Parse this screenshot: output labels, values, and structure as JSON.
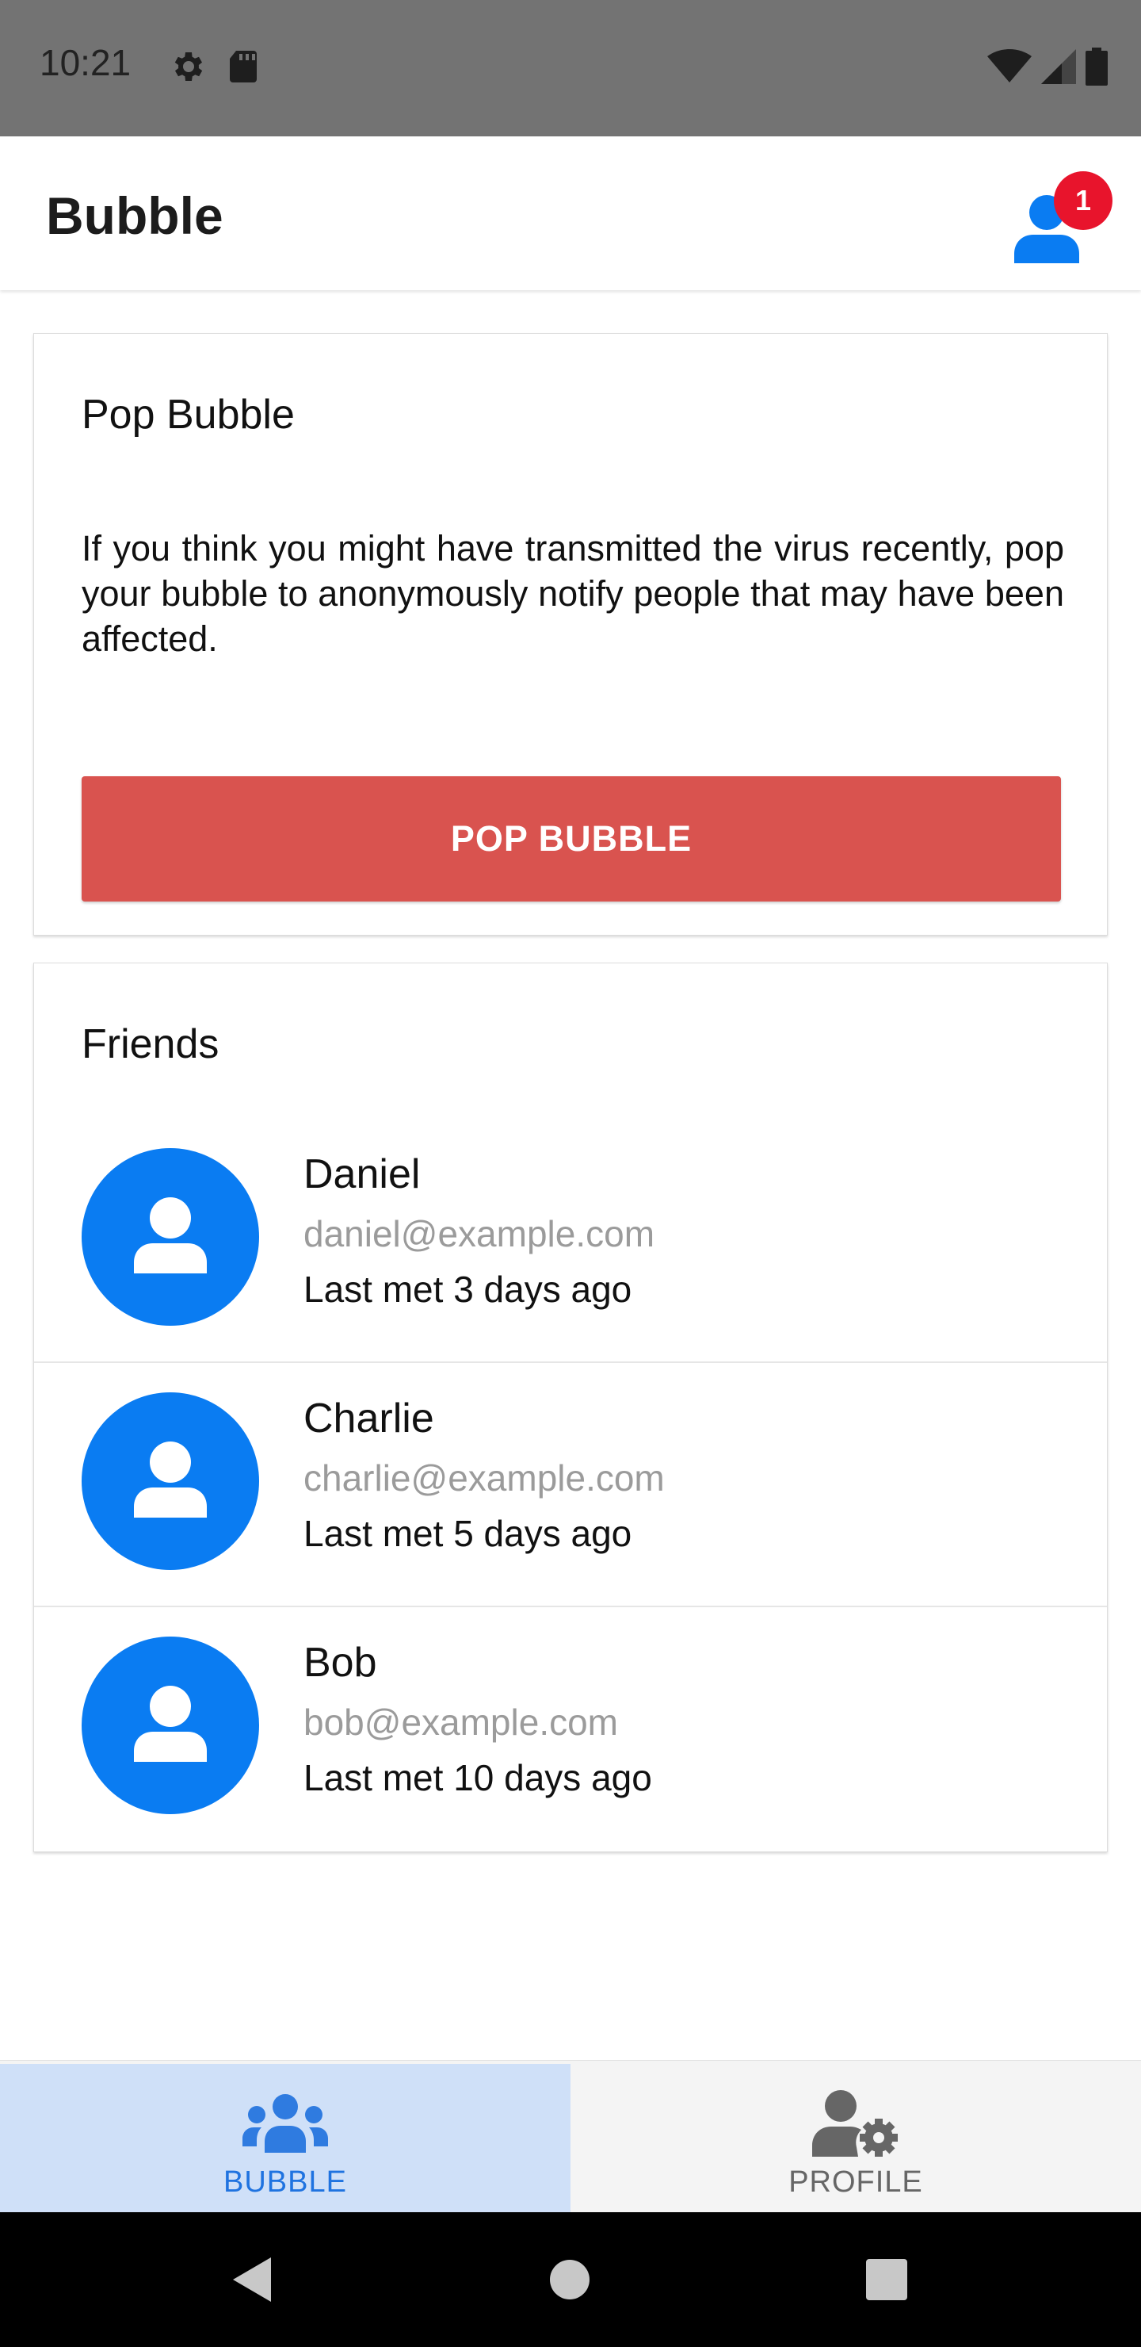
{
  "status_bar": {
    "time": "10:21",
    "icons_left": [
      "settings-icon",
      "sd-card-icon"
    ],
    "icons_right": [
      "wifi-icon",
      "signal-icon",
      "battery-icon"
    ]
  },
  "app_bar": {
    "title": "Bubble",
    "notification_count": "1"
  },
  "pop_card": {
    "title": "Pop Bubble",
    "description": "If you think you might have transmitted the virus recently, pop your bubble to anonymously notify people that may have been affected.",
    "button_label": "POP BUBBLE",
    "button_color": "#d9534f"
  },
  "friends_card": {
    "title": "Friends",
    "friends": [
      {
        "name": "Daniel",
        "email": "daniel@example.com",
        "last_met": "Last met 3 days ago"
      },
      {
        "name": "Charlie",
        "email": "charlie@example.com",
        "last_met": "Last met 5 days ago"
      },
      {
        "name": "Bob",
        "email": "bob@example.com",
        "last_met": "Last met 10 days ago"
      }
    ]
  },
  "bottom_nav": {
    "tabs": [
      {
        "label": "BUBBLE",
        "icon": "group-icon",
        "active": true
      },
      {
        "label": "PROFILE",
        "icon": "user-cog-icon",
        "active": false
      }
    ]
  },
  "colors": {
    "accent": "#0a7cf2",
    "badge": "#e8142c",
    "active_tab_bg": "#cfe0f8",
    "active_tab_text": "#1f73e0"
  }
}
